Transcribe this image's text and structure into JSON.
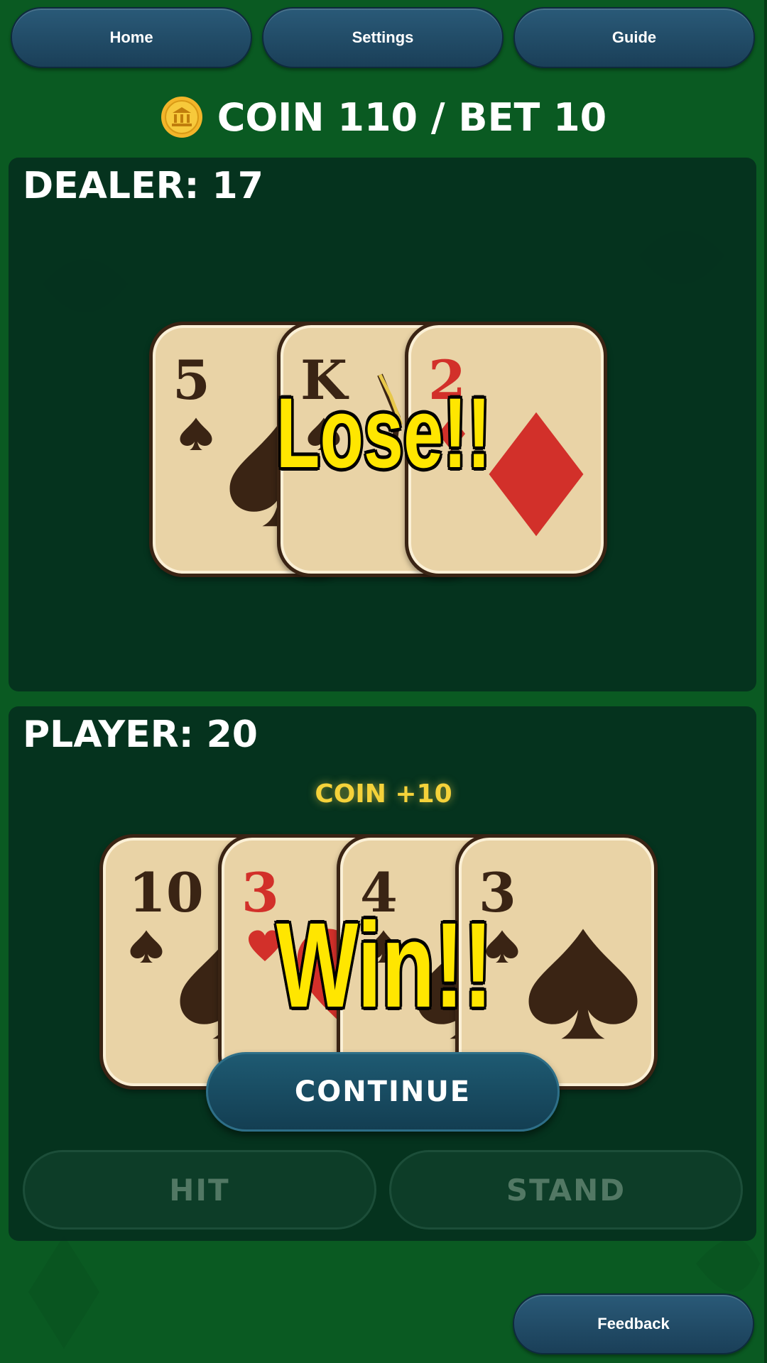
{
  "nav": {
    "home_label": "Home",
    "settings_label": "Settings",
    "guide_label": "Guide"
  },
  "status": {
    "coin_text": "COIN 110 / BET 10"
  },
  "dealer": {
    "title": "DEALER: 17",
    "result": "Lose!!",
    "cards": [
      {
        "rank": "5",
        "suit": "spade",
        "color": "black"
      },
      {
        "rank": "K",
        "suit": "spade",
        "color": "black"
      },
      {
        "rank": "2",
        "suit": "diamond",
        "color": "red"
      }
    ]
  },
  "player": {
    "title": "PLAYER: 20",
    "coin_delta": "COIN +10",
    "result": "Win!!",
    "cards": [
      {
        "rank": "10",
        "suit": "spade",
        "color": "black"
      },
      {
        "rank": "3",
        "suit": "heart",
        "color": "red"
      },
      {
        "rank": "4",
        "suit": "spade",
        "color": "black"
      },
      {
        "rank": "3",
        "suit": "spade",
        "color": "black"
      }
    ]
  },
  "actions": {
    "continue_label": "CONTINUE",
    "hit_label": "HIT",
    "stand_label": "STAND"
  },
  "footer": {
    "feedback_label": "Feedback"
  },
  "colors": {
    "table_green": "#0a5a22",
    "panel": "#052d1e",
    "button_blue": "#1a3f58",
    "result_yellow": "#ffe600",
    "card_face": "#e9d3a6",
    "suit_red": "#d2302a",
    "suit_black": "#3a2414"
  }
}
